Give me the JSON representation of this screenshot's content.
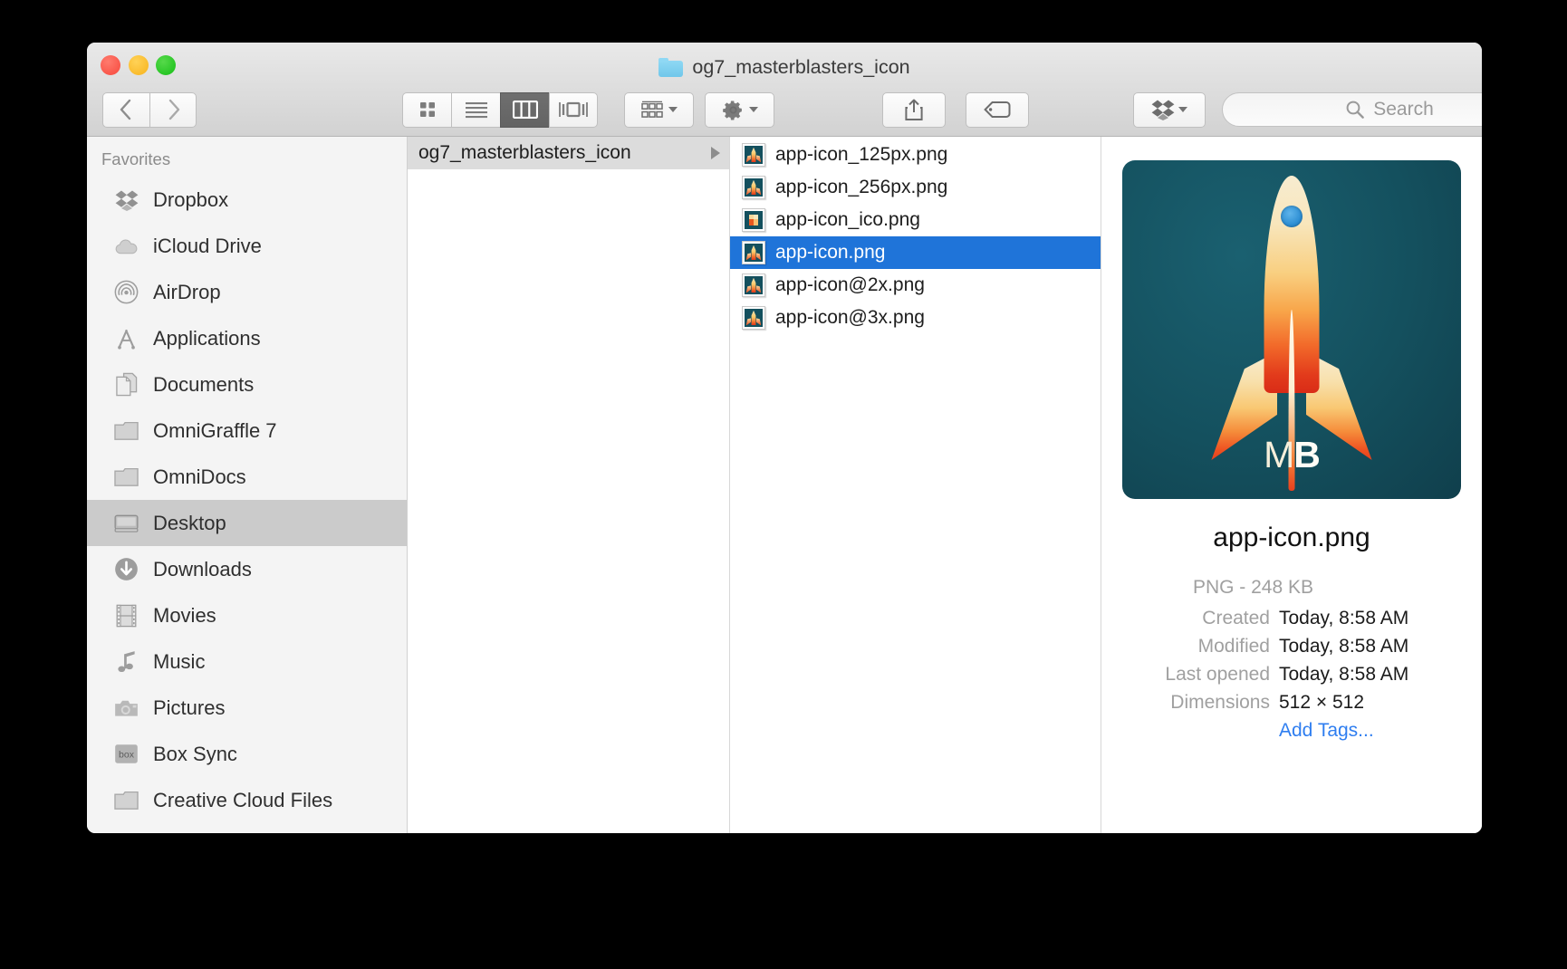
{
  "window": {
    "title": "og7_masterblasters_icon",
    "title_icon": "blue-folder-icon",
    "traffic_lights": {
      "close": "close-window-button",
      "minimize": "minimize-window-button",
      "maximize": "maximize-window-button"
    }
  },
  "toolbar": {
    "back_label": "‹",
    "forward_label": "›",
    "view_modes": [
      {
        "name": "icon-view",
        "label": "icon-grid-icon",
        "active": false
      },
      {
        "name": "list-view",
        "label": "list-lines-icon",
        "active": false
      },
      {
        "name": "column-view",
        "label": "column-view-icon",
        "active": true
      },
      {
        "name": "gallery-view",
        "label": "gallery-view-icon",
        "active": false
      }
    ],
    "arrange_label": "arrange-grid-icon",
    "action_label": "gear-icon",
    "share_label": "share-icon",
    "tag_label": "tag-icon",
    "dropbox_label": "dropbox-icon"
  },
  "search": {
    "placeholder": "Search",
    "value": "",
    "icon": "search-icon"
  },
  "sidebar": {
    "header": "Favorites",
    "items": [
      {
        "label": "Dropbox",
        "icon": "dropbox-icon",
        "selected": false
      },
      {
        "label": "iCloud Drive",
        "icon": "cloud-icon",
        "selected": false
      },
      {
        "label": "AirDrop",
        "icon": "airdrop-icon",
        "selected": false
      },
      {
        "label": "Applications",
        "icon": "applications-icon",
        "selected": false
      },
      {
        "label": "Documents",
        "icon": "documents-icon",
        "selected": false
      },
      {
        "label": "OmniGraffle 7",
        "icon": "folder-icon",
        "selected": false
      },
      {
        "label": "OmniDocs",
        "icon": "folder-icon",
        "selected": false
      },
      {
        "label": "Desktop",
        "icon": "desktop-icon",
        "selected": true
      },
      {
        "label": "Downloads",
        "icon": "downloads-icon",
        "selected": false
      },
      {
        "label": "Movies",
        "icon": "movies-film-icon",
        "selected": false
      },
      {
        "label": "Music",
        "icon": "music-note-icon",
        "selected": false
      },
      {
        "label": "Pictures",
        "icon": "camera-icon",
        "selected": false
      },
      {
        "label": "Box Sync",
        "icon": "box-sync-icon",
        "selected": false
      },
      {
        "label": "Creative Cloud Files",
        "icon": "folder-icon",
        "selected": false
      }
    ]
  },
  "columns": {
    "column_one": [
      {
        "label": "og7_masterblasters_icon",
        "highlighted": true,
        "has_disclosure": true
      }
    ],
    "file_list": [
      {
        "name": "app-icon_125px.png",
        "icon": "rocket-png-thumbnail",
        "selected": false
      },
      {
        "name": "app-icon_256px.png",
        "icon": "rocket-png-thumbnail",
        "selected": false
      },
      {
        "name": "app-icon_ico.png",
        "icon": "pixelated-png-thumbnail",
        "selected": false
      },
      {
        "name": "app-icon.png",
        "icon": "rocket-png-thumbnail",
        "selected": true
      },
      {
        "name": "app-icon@2x.png",
        "icon": "rocket-png-thumbnail",
        "selected": false
      },
      {
        "name": "app-icon@3x.png",
        "icon": "rocket-png-thumbnail",
        "selected": false
      }
    ]
  },
  "preview": {
    "thumbnail_icon": "rocket-app-icon-preview",
    "rocket_badge": {
      "first": "M",
      "second": "B"
    },
    "filename": "app-icon.png",
    "kind_and_size": "PNG - 248 KB",
    "fields": [
      {
        "key": "Created",
        "value": "Today, 8:58 AM"
      },
      {
        "key": "Modified",
        "value": "Today, 8:58 AM"
      },
      {
        "key": "Last opened",
        "value": "Today, 8:58 AM"
      },
      {
        "key": "Dimensions",
        "value": "512 × 512"
      }
    ],
    "add_tags_label": "Add Tags..."
  },
  "colors": {
    "desktop_background": "#000000",
    "selection_blue": "#1f74d9",
    "sidebar_selected": "#cbcbcb",
    "link_blue": "#2f7ef0",
    "icon_teal": "#14505e",
    "titlebar_gray": "#dcdcdc",
    "traffic_red": "#f9564a",
    "traffic_yellow": "#f9bb2c",
    "traffic_green": "#28c625"
  }
}
